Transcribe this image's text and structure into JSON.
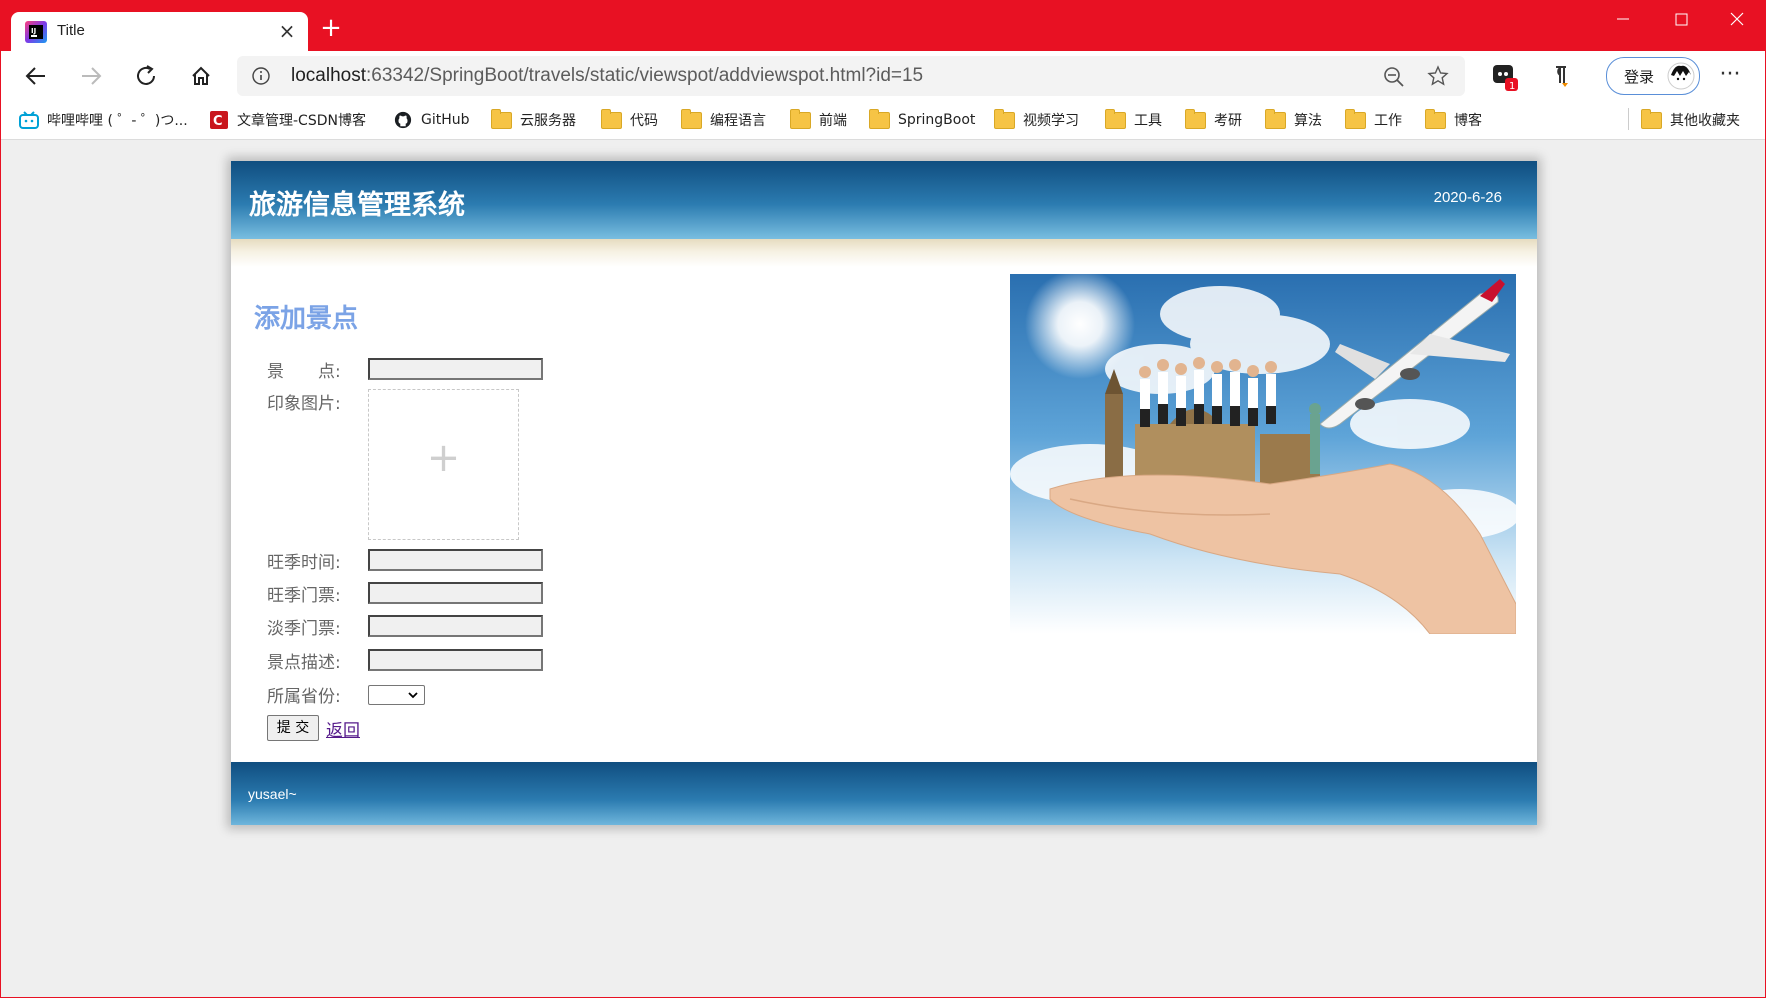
{
  "browser": {
    "tab_title": "Title",
    "url_host": "localhost",
    "url_path": ":63342/SpringBoot/travels/static/viewspot/addviewspot.html?id=15",
    "ext_badge_count": "1",
    "login_label": "登录",
    "accent_color": "#e81123"
  },
  "bookmarks": {
    "items": [
      "哔哩哔哩 ( ゜- ゜)つ...",
      "文章管理-CSDN博客",
      "GitHub",
      "云服务器",
      "代码",
      "编程语言",
      "前端",
      "SpringBoot",
      "视频学习",
      "工具",
      "考研",
      "算法",
      "工作",
      "博客"
    ],
    "other": "其他收藏夹"
  },
  "page": {
    "site_title": "旅游信息管理系统",
    "date": "2020-6-26",
    "form_title": "添加景点",
    "labels": {
      "spot": "景　　点:",
      "image": "印象图片:",
      "peak_time": "旺季时间:",
      "peak_ticket": "旺季门票:",
      "off_ticket": "淡季门票:",
      "description": "景点描述:",
      "province": "所属省份:"
    },
    "upload_plus": "+",
    "submit_label": "提 交",
    "back_label": "返回",
    "footer": "yusael~",
    "header_color": "#104e80",
    "title_color": "#7ba3e6"
  }
}
